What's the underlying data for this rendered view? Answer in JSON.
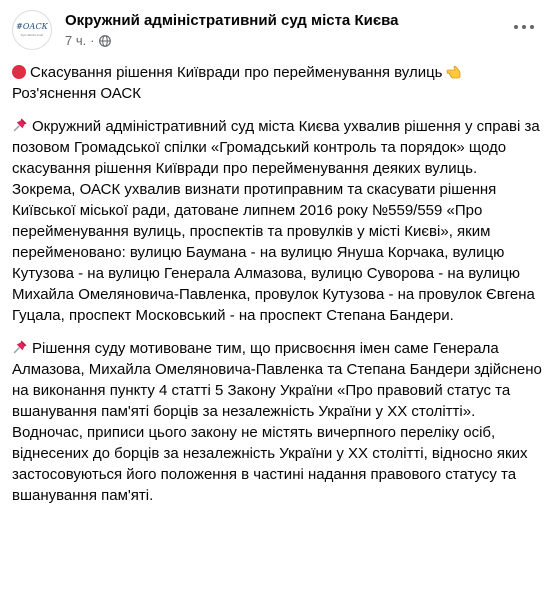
{
  "post": {
    "author": {
      "name": "Окружний адміністративний суд міста Києва",
      "avatar_text": "#ОАСК",
      "avatar_subtext": "Kyiv district court"
    },
    "meta": {
      "time": "7 ч.",
      "separator": "·",
      "privacy_icon": "globe-icon"
    },
    "more_icon": "ellipsis-icon",
    "headline": "Скасування рішення Київради про перейменування вулиць",
    "subheadline": "Роз'яснення ОАСК",
    "paragraph1": "Окружний адміністративний суд міста Києва ухвалив рішення у справі за позовом Громадської спілки «Громадський контроль та порядок» щодо скасування рішення  Київради про перейменування деяких вулиць. Зокрема, ОАСК ухвалив  визнати протиправним та скасувати рішення Київської міської ради, датоване  липнем 2016 року №559/559 «Про перейменування вулиць, проспектів та провулків у місті Києві», яким перейменовано:  вулицю Баумана - на вулицю Януша Корчака, вулицю Кутузова - на вулицю Генерала Алмазова, вулицю Суворова - на вулицю Михайла Омеляновича-Павленка, провулок Кутузова - на провулок Євгена Гуцала, проспект Московський - на проспект Степана Бандери.",
    "paragraph2": "Рішення суду мотивоване тим, що присвоєння імен саме Генерала Алмазова, Михайла Омеляновича-Павленка та Степана Бандери здійснено на виконання пункту 4 статті 5 Закону України «Про правовий статус та вшанування пам'яті борців за незалежність України у XX столітті». Водночас, приписи цього закону не містять вичерпного переліку осіб, віднесених до борців за незалежність України у XX столітті, відносно яких застосовуються його положення в частині надання правового статусу та вшанування пам'яті."
  },
  "colors": {
    "text": "#050505",
    "secondary": "#65676b",
    "red_circle": "#dd2e44",
    "pushpin": "#e0245e",
    "hand": "#ffc83d"
  }
}
